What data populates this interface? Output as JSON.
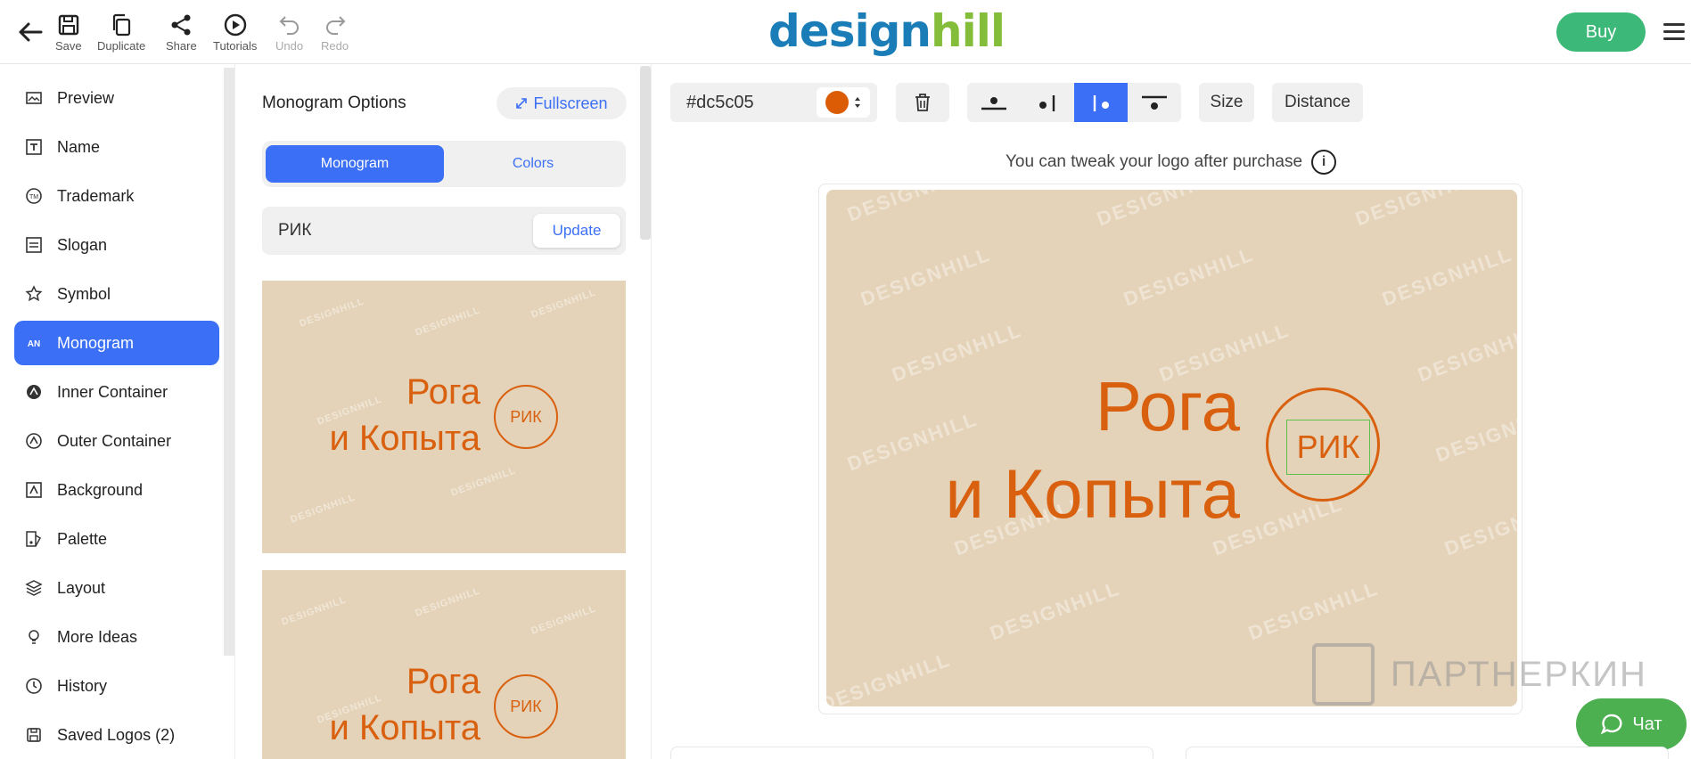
{
  "brand": {
    "logo_left": "design",
    "logo_right": "hill"
  },
  "toolbar": {
    "save": "Save",
    "duplicate": "Duplicate",
    "share": "Share",
    "tutorials": "Tutorials",
    "undo": "Undo",
    "redo": "Redo"
  },
  "buy_label": "Buy",
  "sidebar": {
    "items": [
      {
        "label": "Preview",
        "icon": "preview-icon"
      },
      {
        "label": "Name",
        "icon": "text-icon"
      },
      {
        "label": "Trademark",
        "icon": "trademark-icon"
      },
      {
        "label": "Slogan",
        "icon": "slogan-icon"
      },
      {
        "label": "Symbol",
        "icon": "star-icon"
      },
      {
        "label": "Monogram",
        "icon": "monogram-icon"
      },
      {
        "label": "Inner Container",
        "icon": "inner-container-icon"
      },
      {
        "label": "Outer Container",
        "icon": "outer-container-icon"
      },
      {
        "label": "Background",
        "icon": "background-icon"
      },
      {
        "label": "Palette",
        "icon": "palette-icon"
      },
      {
        "label": "Layout",
        "icon": "layers-icon"
      },
      {
        "label": "More Ideas",
        "icon": "lightbulb-icon"
      },
      {
        "label": "History",
        "icon": "history-icon"
      },
      {
        "label": "Saved Logos (2)",
        "icon": "save-icon"
      }
    ],
    "active": "Monogram"
  },
  "panel": {
    "title": "Monogram Options",
    "fullscreen": "Fullscreen",
    "tabs": [
      "Monogram",
      "Colors"
    ],
    "monogram_value": "РИК",
    "update": "Update",
    "thumbs": [
      {
        "line1": "Рога",
        "line2": "и Копыта",
        "mono": "РИК"
      },
      {
        "line1": "Рога",
        "line2": "и Копыта",
        "mono": "РИК"
      }
    ]
  },
  "editor": {
    "color_hex": "#dc5c05",
    "size": "Size",
    "distance": "Distance",
    "hint": "You can tweak your logo after purchase",
    "info": "i",
    "logo_line1": "Рога",
    "logo_line2": "и Копыта",
    "monogram": "РИК",
    "watermark": "DESIGNHILL"
  },
  "overlay": {
    "partner": "ПАРТНЕРКИН",
    "chat": "Чат"
  },
  "colors": {
    "accent": "#3b6ff5",
    "buy": "#3cb878",
    "logo_orange": "#dc5c05",
    "canvas_bg": "#e4d3b8"
  }
}
